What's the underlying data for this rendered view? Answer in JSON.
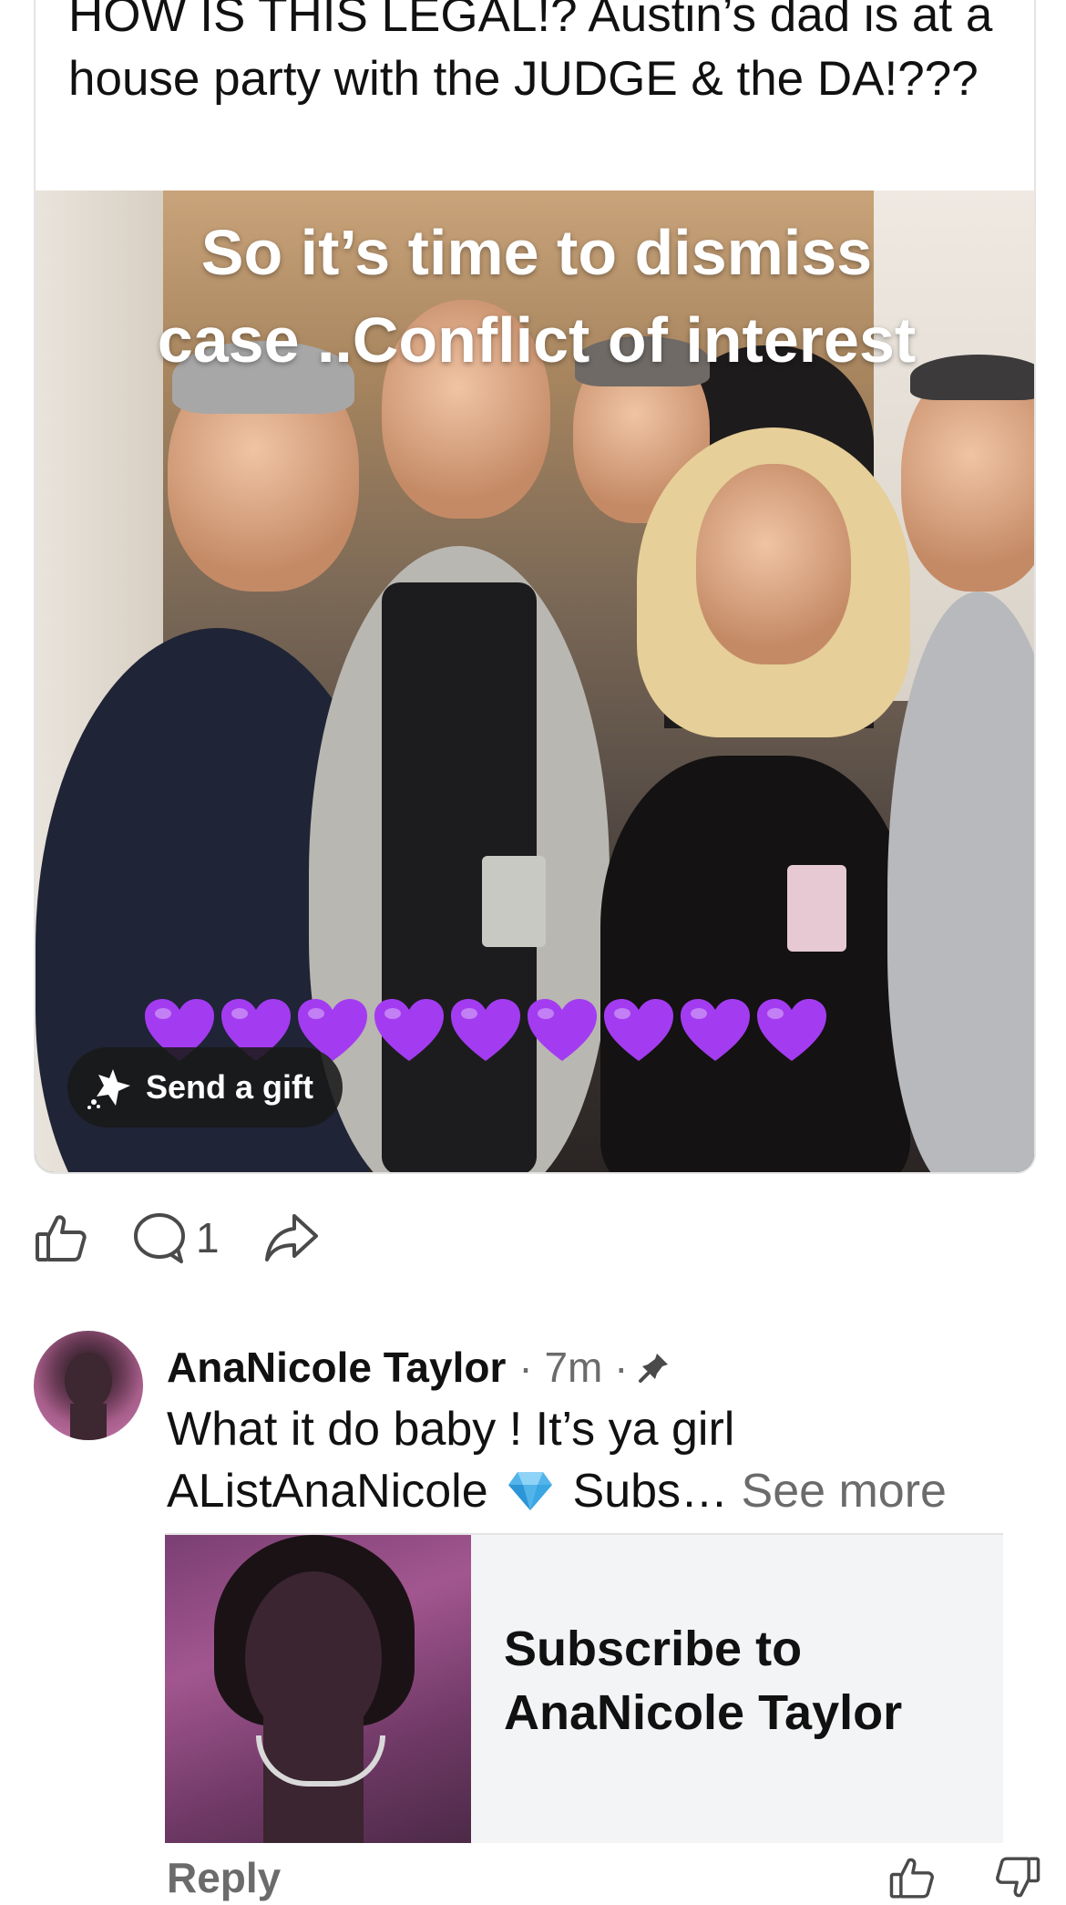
{
  "post": {
    "title": "HOW IS THIS LEGAL!? Austin’s dad is at a house party with the JUDGE & the DA!???",
    "image_caption_line1": "So it’s time to dismiss",
    "image_caption_line2": "case ..Conflict of interest",
    "hearts_count": 9,
    "heart_color": "#a33cf0",
    "gift_label": "Send a gift",
    "gift_icon": "sparkle-gift-icon"
  },
  "actions": {
    "like_icon": "thumbs-up-icon",
    "comment_icon": "comment-bubble-icon",
    "comment_count": "1",
    "share_icon": "share-arrow-icon"
  },
  "comment": {
    "author": "AnaNicole Taylor",
    "meta": "· 7m ·",
    "pin_icon": "pin-icon",
    "body_line1": "What it do baby ! It’s ya girl",
    "body_line2_prefix": "AListAnaNicole",
    "gem_icon": "diamond-gem-icon",
    "body_line2_suffix": "Subs…",
    "see_more": "See more",
    "subscribe_card_title": "Subscribe to AnaNicole Taylor",
    "reply_label": "Reply",
    "upvote_icon": "thumbs-up-icon",
    "downvote_icon": "thumbs-down-icon"
  },
  "colors": {
    "text": "#111111",
    "muted": "#6b6b6b",
    "card_border": "#e4e4e4",
    "subscribe_card_bg": "#f3f4f6",
    "gift_pill_bg": "#191919"
  }
}
